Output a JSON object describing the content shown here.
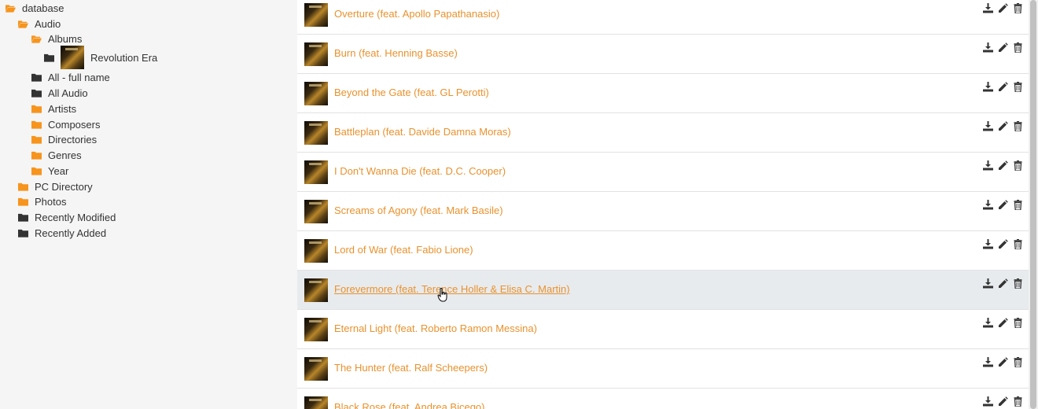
{
  "colors": {
    "folder_orange": "#f7941d",
    "folder_dark": "#333333",
    "link_orange": "#e8922e",
    "row_hover": "#e8ebee"
  },
  "sidebar": {
    "items": [
      {
        "label": "database",
        "icon": "folder-open-icon",
        "color": "orange"
      },
      {
        "label": "Audio",
        "icon": "folder-open-icon",
        "color": "orange"
      },
      {
        "label": "Albums",
        "icon": "folder-open-icon",
        "color": "orange"
      },
      {
        "label": "Revolution Era",
        "icon": "folder-icon",
        "color": "dark"
      },
      {
        "label": "All - full name",
        "icon": "folder-icon",
        "color": "dark"
      },
      {
        "label": "All Audio",
        "icon": "folder-icon",
        "color": "dark"
      },
      {
        "label": "Artists",
        "icon": "folder-icon",
        "color": "orange"
      },
      {
        "label": "Composers",
        "icon": "folder-icon",
        "color": "orange"
      },
      {
        "label": "Directories",
        "icon": "folder-icon",
        "color": "orange"
      },
      {
        "label": "Genres",
        "icon": "folder-icon",
        "color": "orange"
      },
      {
        "label": "Year",
        "icon": "folder-icon",
        "color": "orange"
      },
      {
        "label": "PC Directory",
        "icon": "folder-icon",
        "color": "orange"
      },
      {
        "label": "Photos",
        "icon": "folder-icon",
        "color": "orange"
      },
      {
        "label": "Recently Modified",
        "icon": "folder-icon",
        "color": "dark"
      },
      {
        "label": "Recently Added",
        "icon": "folder-icon",
        "color": "dark"
      }
    ]
  },
  "tracks": [
    {
      "title": "Overture (feat. Apollo Papathanasio)"
    },
    {
      "title": "Burn (feat. Henning Basse)"
    },
    {
      "title": "Beyond the Gate (feat. GL Perotti)"
    },
    {
      "title": "Battleplan (feat. Davide Damna Moras)"
    },
    {
      "title": "I Don't Wanna Die (feat. D.C. Cooper)"
    },
    {
      "title": "Screams of Agony (feat. Mark Basile)"
    },
    {
      "title": "Lord of War (feat. Fabio Lione)"
    },
    {
      "title": "Forevermore (feat. Terence Holler & Elisa C. Martin)"
    },
    {
      "title": "Eternal Light (feat. Roberto Ramon Messina)"
    },
    {
      "title": "The Hunter (feat. Ralf Scheepers)"
    },
    {
      "title": "Black Rose (feat. Andrea Bicego)"
    }
  ],
  "row_actions": [
    "download-icon",
    "edit-pencil-icon",
    "trash-icon"
  ]
}
